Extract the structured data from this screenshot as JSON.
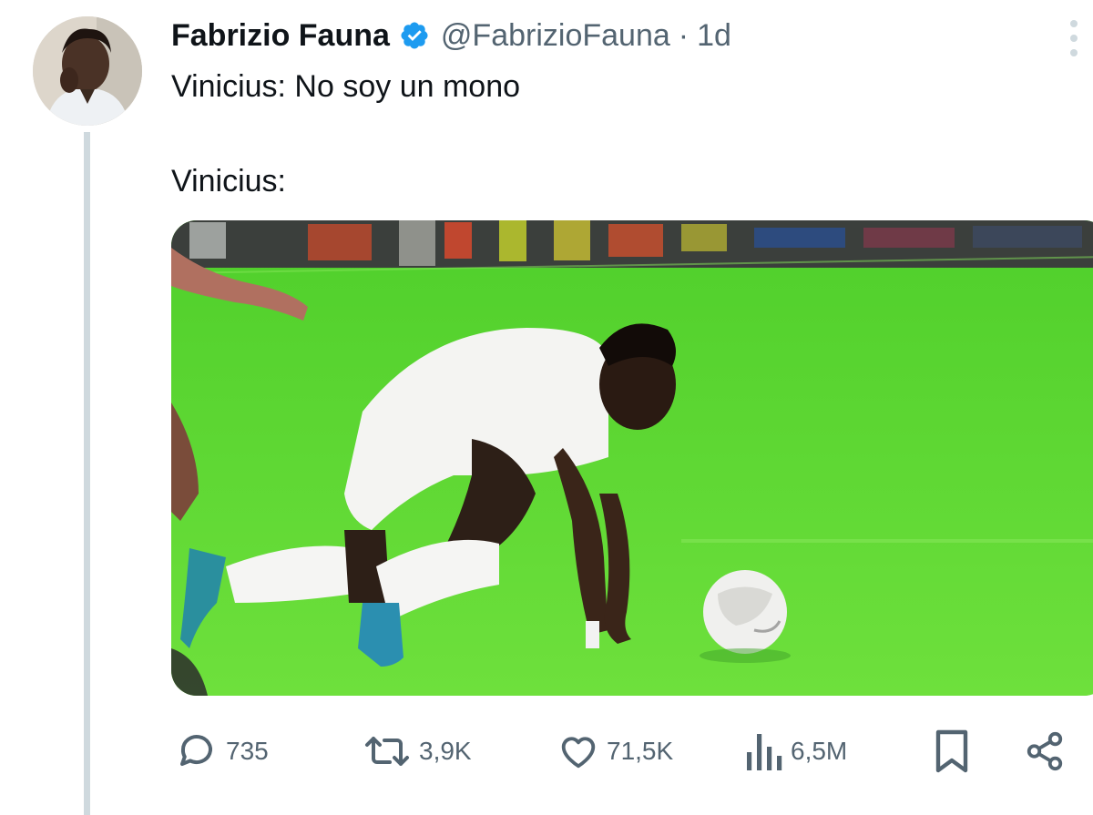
{
  "tweet": {
    "author": {
      "display_name": "Fabrizio Fauna",
      "handle": "@FabrizioFauna",
      "verified_icon": "verified-badge-icon",
      "verified_color": "#1d9bf0"
    },
    "separator": "·",
    "time": "1d",
    "text_line_1": "Vinicius: No soy un mono",
    "text_line_2": "Vinicius:",
    "media": {
      "type": "video-still",
      "pitch_color": "#6ad83a"
    }
  },
  "actions": {
    "reply": {
      "icon": "reply-icon",
      "count": "735"
    },
    "retweet": {
      "icon": "retweet-icon",
      "count": "3,9K"
    },
    "like": {
      "icon": "heart-icon",
      "count": "71,5K"
    },
    "views": {
      "icon": "views-icon",
      "count": "6,5M"
    },
    "bookmark": {
      "icon": "bookmark-icon"
    },
    "share": {
      "icon": "share-icon"
    }
  },
  "more_icon": "more-icon"
}
